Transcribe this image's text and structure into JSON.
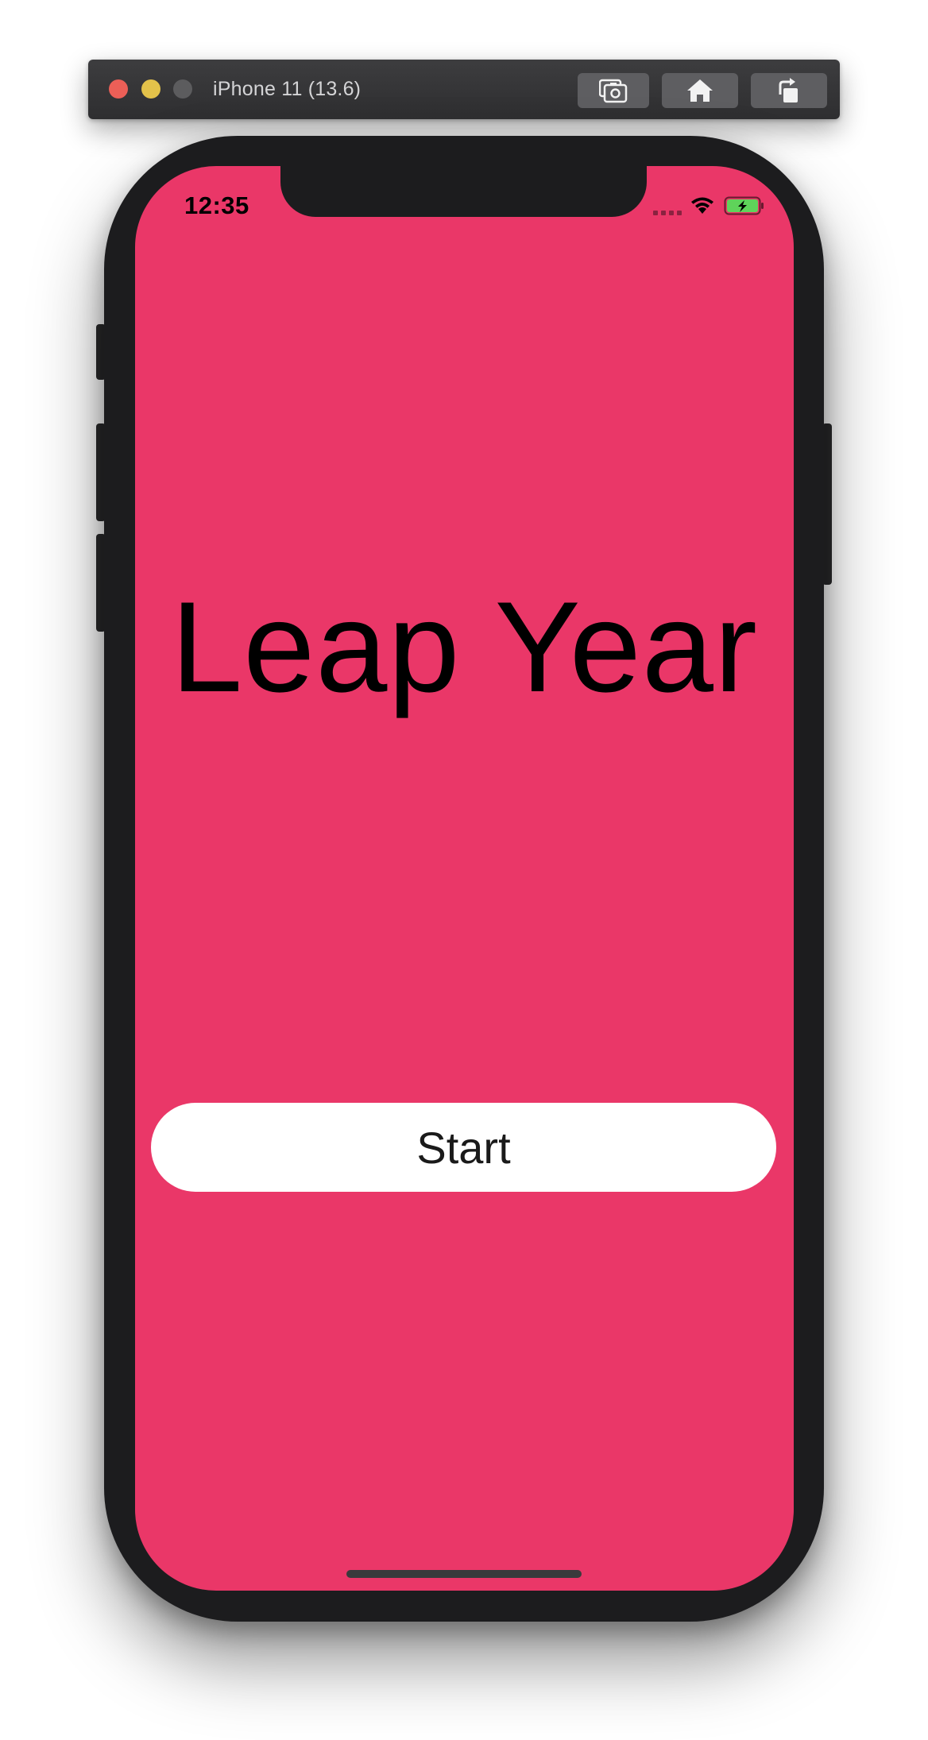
{
  "window": {
    "title": "iPhone 11 (13.6)",
    "toolbar_icons": [
      "screenshot-icon",
      "home-icon",
      "rotate-icon"
    ]
  },
  "status_bar": {
    "time": "12:35"
  },
  "app": {
    "title": "Leap Year",
    "start_label": "Start"
  },
  "colors": {
    "screen_background": "#ea3768",
    "button_background": "#ffffff",
    "device_body": "#1c1c1e",
    "battery_fill": "#5fd35a"
  }
}
